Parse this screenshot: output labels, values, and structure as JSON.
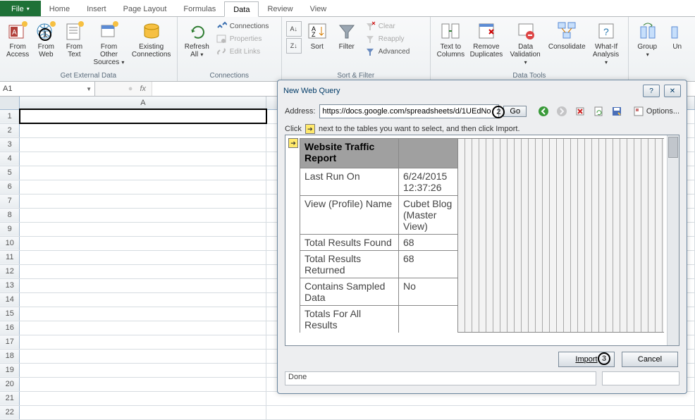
{
  "tabs": {
    "file": "File",
    "home": "Home",
    "insert": "Insert",
    "page_layout": "Page Layout",
    "formulas": "Formulas",
    "data": "Data",
    "review": "Review",
    "view": "View"
  },
  "ribbon": {
    "from_access": "From\nAccess",
    "from_web": "From\nWeb",
    "from_text": "From\nText",
    "from_other": "From Other\nSources",
    "existing_conn": "Existing\nConnections",
    "get_external": "Get External Data",
    "refresh_all": "Refresh\nAll",
    "connections": "Connections",
    "properties": "Properties",
    "edit_links": "Edit Links",
    "conn_group": "Connections",
    "sort": "Sort",
    "filter": "Filter",
    "clear": "Clear",
    "reapply": "Reapply",
    "advanced": "Advanced",
    "sort_filter": "Sort & Filter",
    "text_to_cols": "Text to\nColumns",
    "remove_dup": "Remove\nDuplicates",
    "data_val": "Data\nValidation",
    "consolidate": "Consolidate",
    "whatif": "What-If\nAnalysis",
    "data_tools": "Data Tools",
    "group": "Group",
    "un": "Un"
  },
  "namebox": "A1",
  "col_a": "A",
  "dialog": {
    "title": "New Web Query",
    "address_label": "Address:",
    "address_value": "https://docs.google.com/spreadsheets/d/1UEdNo",
    "go": "Go",
    "options": "Options...",
    "hint_pre": "Click",
    "hint_post": "next to the tables you want to select, and then click Import.",
    "import": "Import",
    "cancel": "Cancel",
    "done": "Done"
  },
  "web": {
    "h1": "Website Traffic Report",
    "r1a": "Last Run On",
    "r1b": "6/24/2015 12:37:26",
    "r2a": "View (Profile) Name",
    "r2b": "Cubet Blog (Master View)",
    "r3a": "Total Results Found",
    "r3b": "68",
    "r4a": "Total Results Returned",
    "r4b": "68",
    "r5a": "Contains Sampled Data",
    "r5b": "No",
    "r6a": "Totals For All Results"
  },
  "ann": {
    "n1": "1",
    "n2": "2",
    "n3": "3"
  }
}
